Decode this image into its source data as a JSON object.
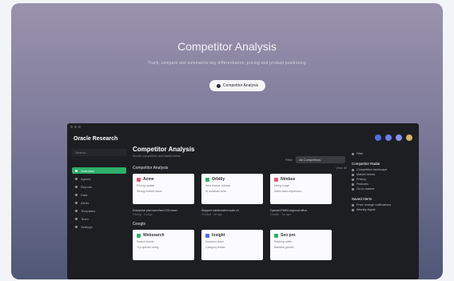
{
  "hero": {
    "title": "Competitor Analysis",
    "subtitle": "Track, compare and summarize key differentiators, pricing and product positioning",
    "button": "Competitor Analysis"
  },
  "app": {
    "brand": "Oracle Research",
    "top_icon_colors": [
      "#4a6fe0",
      "#6a7ef0",
      "#8a8ff2",
      "#d8b26a"
    ],
    "sidebar": {
      "search": "Search...",
      "items": [
        "Overview",
        "Agents",
        "Reports",
        "Data",
        "Alerts",
        "Templates",
        "Team",
        "Settings"
      ],
      "active_color": "#2fae6a"
    },
    "main": {
      "title": "Competitor Analysis",
      "subtitle": "Monitor competitors and market trends",
      "filter_label": "Filter",
      "filter_value": "All Competitors",
      "section1": "Competitor Analysis",
      "section1_action": "View all",
      "cards1": [
        {
          "name": "Acme",
          "color": "#e05a7a",
          "line1": "Pricing update",
          "line2": "Strong market share",
          "foot": "Enterprise plan launched 12% lower",
          "foot_sub": "Pricing · 2d ago"
        },
        {
          "name": "Orbitly",
          "color": "#2fae6a",
          "line1": "New feature release",
          "line2": "AI assistant beta",
          "foot": "Shipped collaboration suite v3",
          "foot_sub": "Product · 4d ago"
        },
        {
          "name": "Nimbus",
          "color": "#e05a7a",
          "line1": "Hiring surge",
          "line2": "Sales team expansion",
          "foot": "Opened EMEA regional office",
          "foot_sub": "Growth · 1w ago"
        }
      ],
      "section2": "Google",
      "cards2": [
        {
          "name": "Websearch",
          "color": "#2fae6a",
          "line1": "Search trends",
          "line2": "Top queries rising"
        },
        {
          "name": "Insight",
          "color": "#4a6fe0",
          "line1": "Keyword share",
          "line2": "Category leader"
        },
        {
          "name": "Seo pro",
          "color": "#2fae6a",
          "line1": "Ranking shifts",
          "line2": "Backlink growth"
        }
      ]
    },
    "right_panel": {
      "top_item": "Filter",
      "h1": "Competitor Radar",
      "items1": [
        "Competitive landscape",
        "Market trends",
        "Pricing",
        "Features",
        "Go-to-market"
      ],
      "h2": "Saved Alerts",
      "items2": [
        "Price change notifications",
        "Weekly digest"
      ]
    }
  }
}
